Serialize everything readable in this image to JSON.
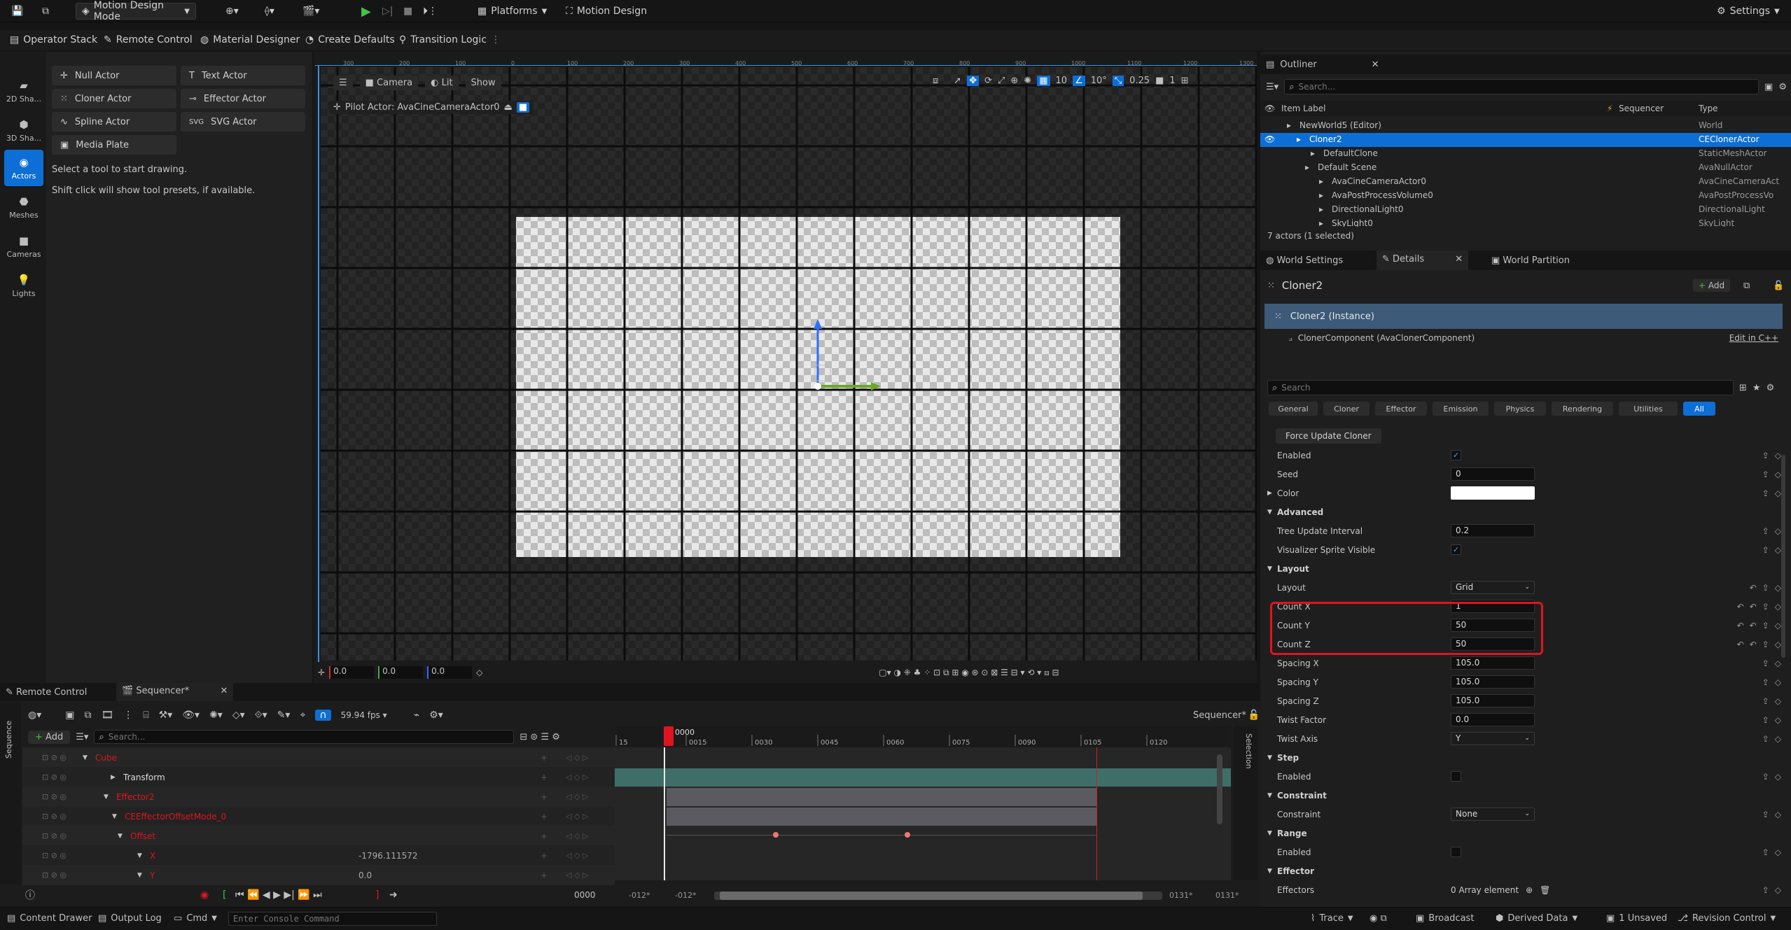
{
  "topbar": {
    "mode_label": "Motion Design Mode",
    "platforms_label": "Platforms",
    "motion_design_label": "Motion Design",
    "settings_label": "Settings"
  },
  "toolbar2": {
    "items": [
      "Operator Stack",
      "Remote Control",
      "Material Designer",
      "Create Defaults",
      "Transition Logic"
    ]
  },
  "leftcol": {
    "items": [
      "2D Sha...",
      "3D Sha...",
      "Actors",
      "Meshes",
      "Cameras",
      "Lights"
    ]
  },
  "tools": {
    "items": [
      "Null Actor",
      "Text Actor",
      "Cloner Actor",
      "Effector Actor",
      "Spline Actor",
      "SVG Actor",
      "Media Plate"
    ],
    "hint1": "Select a tool to start drawing.",
    "hint2": "Shift click will show tool presets, if available."
  },
  "viewport": {
    "camera_label": "Camera",
    "lit_label": "Lit",
    "show_label": "Show",
    "pilot_label": "Pilot Actor: AvaCineCameraActor0",
    "grid_snap": "10",
    "rot_snap": "10°",
    "scale_snap": "0.25",
    "cam_speed": "1",
    "ruler_ticks": [
      "300",
      "200",
      "100",
      "0",
      "100",
      "200",
      "300",
      "400",
      "500",
      "600",
      "700",
      "800",
      "900",
      "1000",
      "1100",
      "1200",
      "1300"
    ],
    "coord_x": "0.0",
    "coord_y": "0.0",
    "coord_z": "0.0"
  },
  "outliner": {
    "title": "Outliner",
    "search_placeholder": "Search...",
    "col_label": "Item Label",
    "col_sequencer": "Sequencer",
    "col_type": "Type",
    "rows": [
      {
        "label": "NewWorld5 (Editor)",
        "type": "World"
      },
      {
        "label": "Cloner2",
        "type": "CEClonerActor"
      },
      {
        "label": "DefaultClone",
        "type": "StaticMeshActor"
      },
      {
        "label": "Default Scene",
        "type": "AvaNullActor"
      },
      {
        "label": "AvaCineCameraActor0",
        "type": "AvaCineCameraAct"
      },
      {
        "label": "AvaPostProcessVolume0",
        "type": "AvaPostProcessVo"
      },
      {
        "label": "DirectionalLight0",
        "type": "DirectionalLight"
      },
      {
        "label": "SkyLight0",
        "type": "SkyLight"
      }
    ],
    "status": "7 actors (1 selected)"
  },
  "details": {
    "tab_world_settings": "World Settings",
    "tab_details": "Details",
    "tab_world_partition": "World Partition",
    "actor_name": "Cloner2",
    "add_label": "Add",
    "instance_label": "Cloner2 (Instance)",
    "component_label": "ClonerComponent (AvaClonerComponent)",
    "edit_cpp": "Edit in C++",
    "search_placeholder": "Search",
    "categories": [
      "General",
      "Cloner",
      "Effector",
      "Emission",
      "Physics",
      "Rendering",
      "Utilities",
      "All"
    ],
    "force_update": "Force Update Cloner",
    "props": {
      "enabled": "Enabled",
      "seed": "Seed",
      "seed_val": "0",
      "color": "Color",
      "advanced": "Advanced",
      "tree_update": "Tree Update Interval",
      "tree_update_val": "0.2",
      "vis_sprite": "Visualizer Sprite Visible",
      "layout_sect": "Layout",
      "layout": "Layout",
      "layout_val": "Grid",
      "count_x": "Count X",
      "count_x_val": "1",
      "count_y": "Count Y",
      "count_y_val": "50",
      "count_z": "Count Z",
      "count_z_val": "50",
      "spacing_x": "Spacing X",
      "spacing_x_val": "105.0",
      "spacing_y": "Spacing Y",
      "spacing_y_val": "105.0",
      "spacing_z": "Spacing Z",
      "spacing_z_val": "105.0",
      "twist_factor": "Twist Factor",
      "twist_factor_val": "0.0",
      "twist_axis": "Twist Axis",
      "twist_axis_val": "Y",
      "step": "Step",
      "step_enabled": "Enabled",
      "constraint_sect": "Constraint",
      "constraint": "Constraint",
      "constraint_val": "None",
      "range": "Range",
      "range_enabled": "Enabled",
      "effector_sect": "Effector",
      "effectors": "Effectors",
      "effectors_val": "0 Array element"
    }
  },
  "sequencer": {
    "tab_remote": "Remote Control",
    "tab_sequencer": "Sequencer*",
    "add_label": "Add",
    "search_placeholder": "Search...",
    "fps": "59.94 fps",
    "seq_name": "Sequencer*",
    "side_label": "Sequence",
    "selection_label": "Selection",
    "current_frame": "0000",
    "frame_ticks": [
      "15",
      "0015",
      "0030",
      "0045",
      "0060",
      "0075",
      "0090",
      "0105",
      "0120"
    ],
    "tracks": [
      {
        "name": "Cube",
        "value": ""
      },
      {
        "name": "Transform",
        "value": ""
      },
      {
        "name": "Effector2",
        "value": ""
      },
      {
        "name": "CEEffectorOffsetMode_0",
        "value": ""
      },
      {
        "name": "Offset",
        "value": ""
      },
      {
        "name": "X",
        "value": "-1796.111572"
      },
      {
        "name": "Y",
        "value": "0.0"
      }
    ],
    "range_start": "-012*",
    "range_start2": "-012*",
    "range_end": "0131*",
    "range_end2": "0131*",
    "transport_frame": "0000"
  },
  "statusbar": {
    "content_drawer": "Content Drawer",
    "output_log": "Output Log",
    "cmd": "Cmd",
    "console_placeholder": "Enter Console Command",
    "trace": "Trace",
    "broadcast": "Broadcast",
    "derived_data": "Derived Data",
    "unsaved": "1 Unsaved",
    "revision": "Revision Control"
  },
  "colors": {
    "accent": "#0d6fd6",
    "highlight_red": "#e0141e",
    "selection_bar": "#3d5a78",
    "track_teal": "#3f6e68"
  }
}
